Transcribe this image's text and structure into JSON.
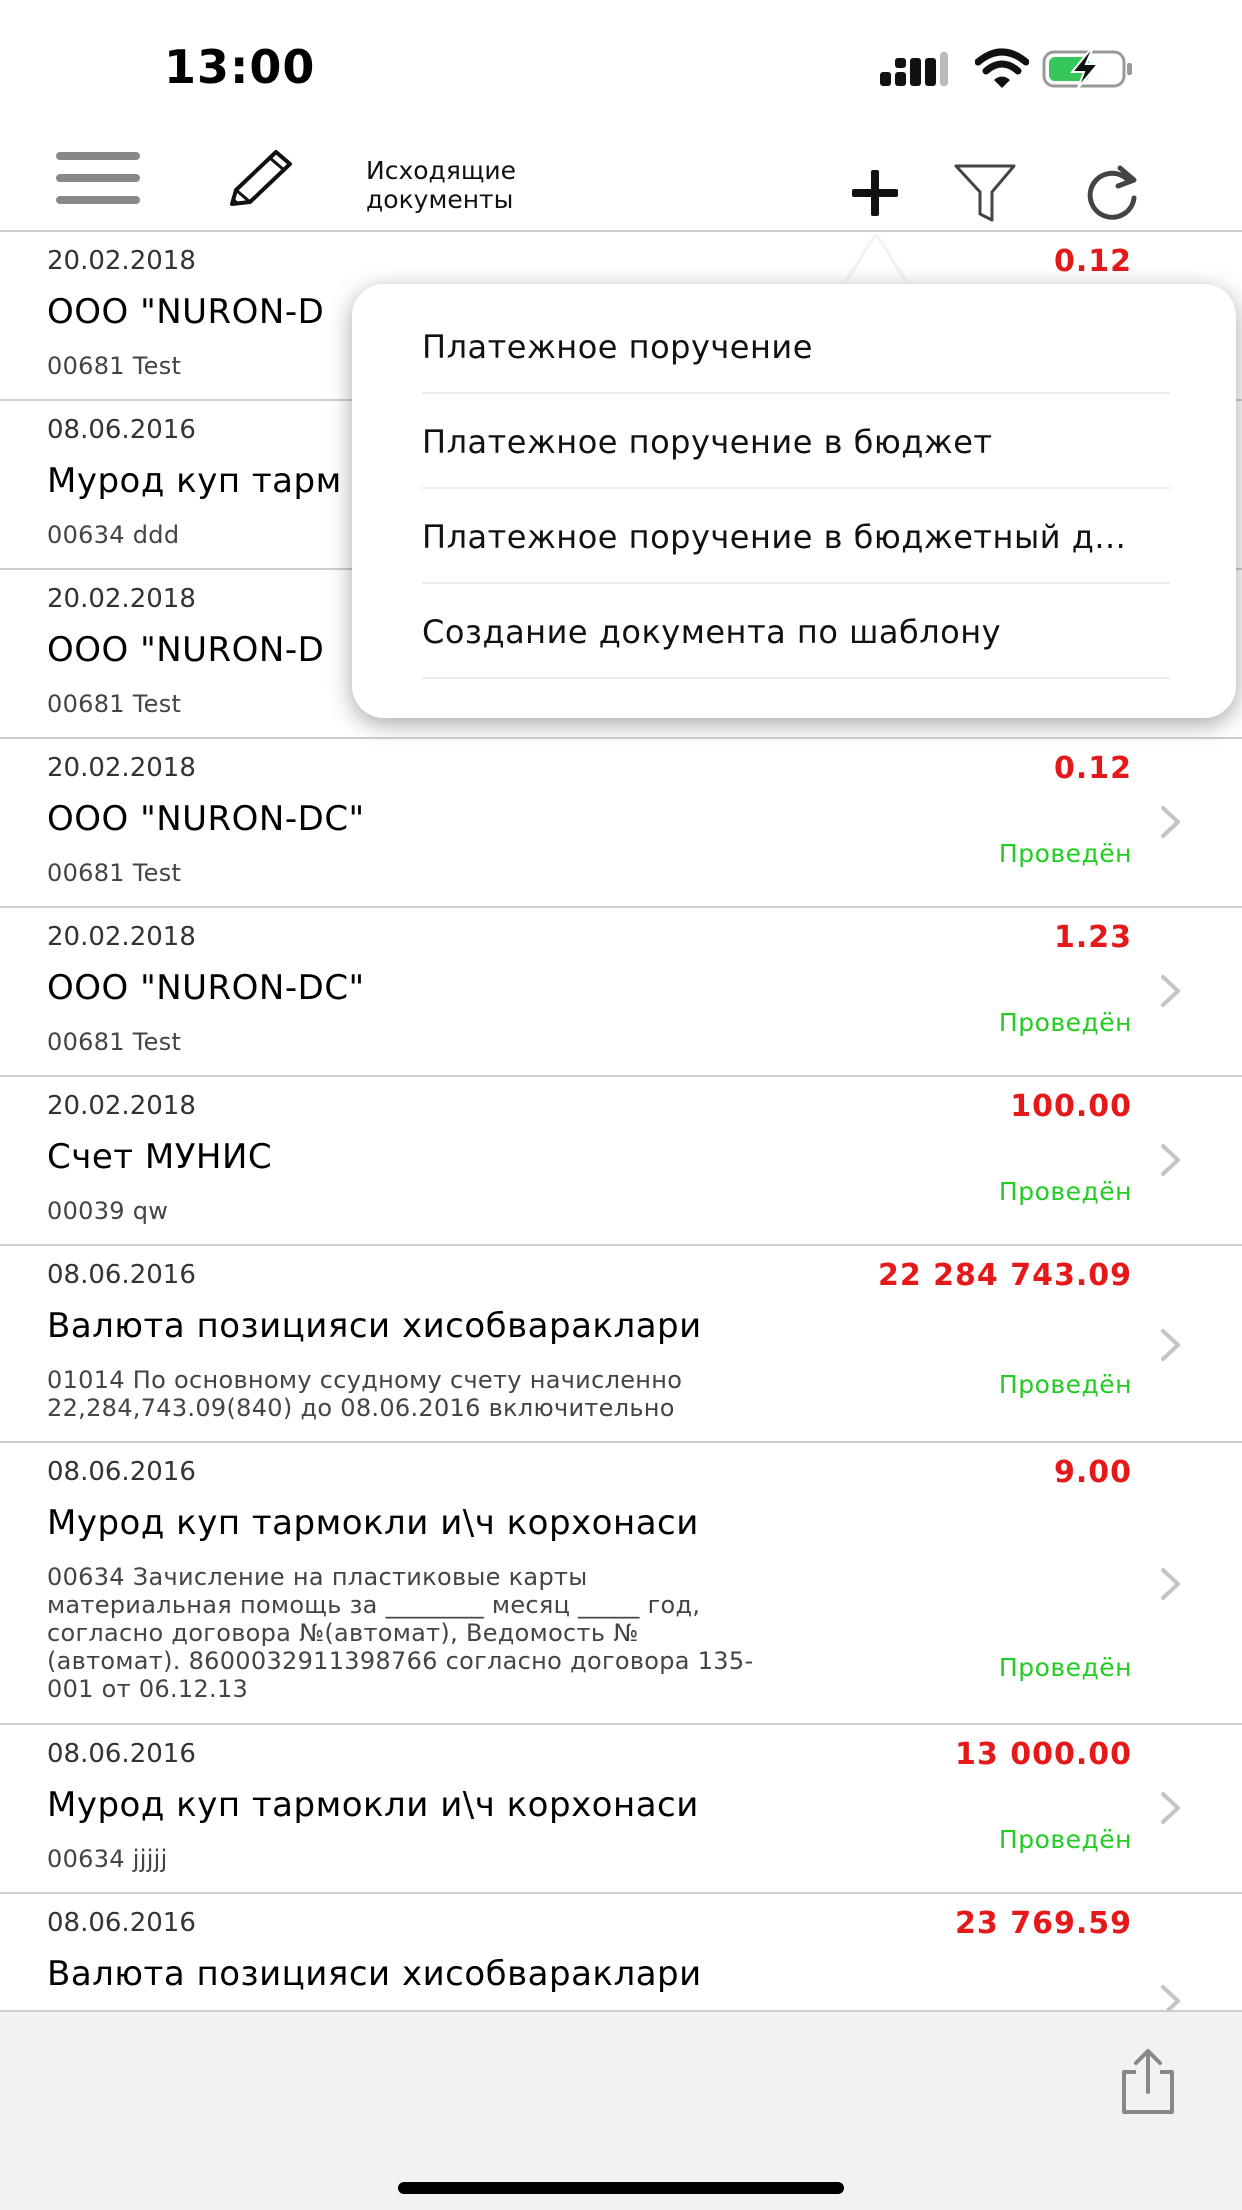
{
  "status_bar": {
    "time": "13:00",
    "icons": [
      "signal-icon",
      "wifi-icon",
      "battery-charging-icon"
    ]
  },
  "nav": {
    "title": "Исходящие\nдокументы",
    "icons": [
      "menu-icon",
      "edit-icon",
      "plus-icon",
      "filter-icon",
      "refresh-icon"
    ]
  },
  "popover": {
    "items": [
      {
        "label": "Платежное поручение"
      },
      {
        "label": "Платежное поручение в бюджет"
      },
      {
        "label": "Платежное поручение в бюджетный д..."
      },
      {
        "label": "Создание документа по шаблону"
      }
    ]
  },
  "documents": [
    {
      "date": "20.02.2018",
      "amount": "0.12",
      "title": "ООО \"NURON-D",
      "sub": "00681 Test",
      "status": ""
    },
    {
      "date": "08.06.2016",
      "amount": "",
      "title": "Мурод куп тарм",
      "sub": "00634 ddd",
      "status": ""
    },
    {
      "date": "20.02.2018",
      "amount": "",
      "title": "ООО \"NURON-D",
      "sub": "00681 Test",
      "status": ""
    },
    {
      "date": "20.02.2018",
      "amount": "0.12",
      "title": "ООО \"NURON-DC\"",
      "sub": "00681 Test",
      "status": "Проведён"
    },
    {
      "date": "20.02.2018",
      "amount": "1.23",
      "title": "ООО \"NURON-DC\"",
      "sub": "00681 Test",
      "status": "Проведён"
    },
    {
      "date": "20.02.2018",
      "amount": "100.00",
      "title": "Счет МУНИС",
      "sub": "00039 qw",
      "status": "Проведён"
    },
    {
      "date": "08.06.2016",
      "amount": "22 284 743.09",
      "title": "Валюта позицияси хисобвараклари",
      "sub": "01014 По основному ссудному счету начисленно 22,284,743.09(840) до 08.06.2016 включительно",
      "status": "Проведён"
    },
    {
      "date": "08.06.2016",
      "amount": "9.00",
      "title": "Мурод куп тармокли и\\ч корхонаси",
      "sub": "00634 Зачисление на пластиковые карты материальная помощь за ________ месяц _____ год, согласно договора №(автомат), Ведомость №(автомат). 8600032911398766 согласно договора 135-001 от 06.12.13",
      "status": "Проведён"
    },
    {
      "date": "08.06.2016",
      "amount": "13 000.00",
      "title": "Мурод куп тармокли и\\ч корхонаси",
      "sub": "00634 jjjjj",
      "status": "Проведён"
    },
    {
      "date": "08.06.2016",
      "amount": "23 769.59",
      "title": "Валюта позицияси хисобвараклари",
      "sub": "",
      "status": ""
    }
  ],
  "bottom_bar": {
    "icons": [
      "share-icon"
    ]
  },
  "colors": {
    "amount": "#e6191a",
    "status": "#22cc22",
    "separator": "#cfcfcf",
    "bottom_bar_bg": "#f2f2f2"
  }
}
